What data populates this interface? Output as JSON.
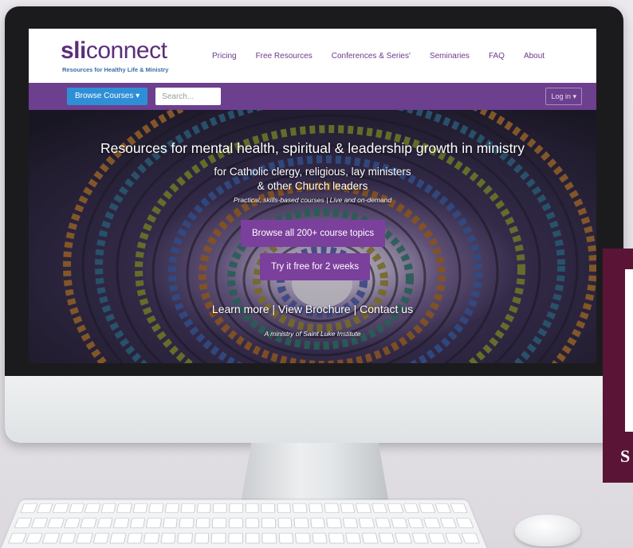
{
  "logo": {
    "brand_part1": "sli",
    "brand_part2": "connect",
    "tagline": "Resources for Healthy Life & Ministry"
  },
  "nav": {
    "links": [
      "Pricing",
      "Free Resources",
      "Conferences & Series'",
      "Seminaries",
      "FAQ",
      "About"
    ]
  },
  "toolbar": {
    "browse_label": "Browse Courses ▾",
    "search_placeholder": "Search...",
    "login_label": "Log in ▾"
  },
  "hero": {
    "title": "Resources for mental health, spiritual & leadership growth in ministry",
    "subtitle_line1": "for Catholic clergy, religious, lay ministers",
    "subtitle_line2": "& other Church leaders",
    "tagline": "Practical, skills-based courses | Live and on-demand",
    "cta_browse": "Browse all 200+ course topics",
    "cta_trial": "Try it free for 2 weeks",
    "link_learn": "Learn more",
    "link_brochure": "View Brochure",
    "link_contact": "Contact us",
    "separator": "|",
    "ministry_note": "A ministry of Saint Luke Institute"
  },
  "overlay": {
    "letter": "S"
  },
  "colors": {
    "brand_purple": "#6d3f8f",
    "button_blue": "#2f8fd6",
    "cta_purple": "#7b3f9c",
    "overlay_maroon": "#5a1536"
  }
}
